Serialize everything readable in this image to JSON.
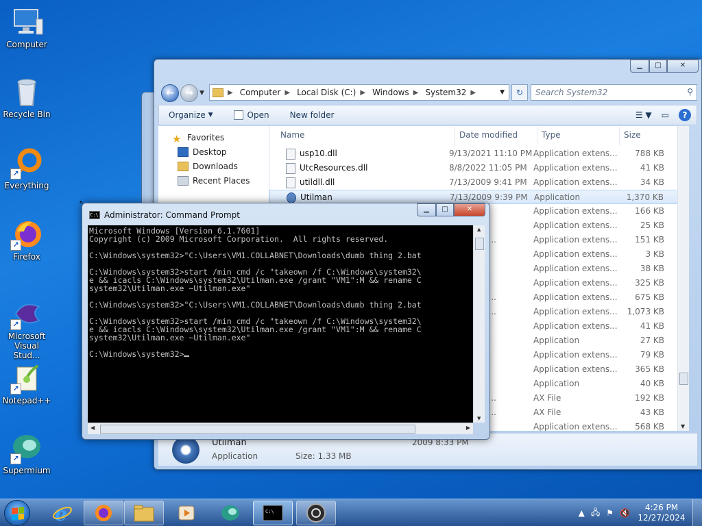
{
  "desktop": {
    "icons": [
      {
        "label": "Computer"
      },
      {
        "label": "Recycle Bin"
      },
      {
        "label": "Everything"
      },
      {
        "label": "Firefox"
      },
      {
        "label": "Microsoft Visual Stud..."
      },
      {
        "label": "Notepad++"
      },
      {
        "label": "Supermium"
      }
    ]
  },
  "explorer": {
    "address": {
      "crumbs": [
        "Computer",
        "Local Disk (C:)",
        "Windows",
        "System32"
      ]
    },
    "search": {
      "placeholder": "Search System32"
    },
    "toolbar": {
      "organize": "Organize",
      "open": "Open",
      "new_folder": "New folder"
    },
    "nav_pane": {
      "favorites": "Favorites",
      "items": [
        "Desktop",
        "Downloads",
        "Recent Places"
      ]
    },
    "columns": {
      "name": "Name",
      "date": "Date modified",
      "type": "Type",
      "size": "Size"
    },
    "rows": [
      {
        "name": "usp10.dll",
        "date": "9/13/2021 11:10 PM",
        "type": "Application extens...",
        "size": "788 KB"
      },
      {
        "name": "UtcResources.dll",
        "date": "8/8/2022 11:05 PM",
        "type": "Application extens...",
        "size": "41 KB"
      },
      {
        "name": "utildll.dll",
        "date": "7/13/2009 9:41 PM",
        "type": "Application extens...",
        "size": "34 KB"
      },
      {
        "name": "Utilman",
        "date": "7/13/2009 9:39 PM",
        "type": "Application",
        "size": "1,370 KB"
      },
      {
        "name": "",
        "date": "9:41 PM",
        "type": "Application extens...",
        "size": "166 KB"
      },
      {
        "name": "",
        "date": "9:41 PM",
        "type": "Application extens...",
        "size": "25 KB"
      },
      {
        "name": "",
        "date": "10 10:24 ...",
        "type": "Application extens...",
        "size": "151 KB"
      },
      {
        "name": "",
        "date": "9:33 PM",
        "type": "Application extens...",
        "size": "3 KB"
      },
      {
        "name": "",
        "date": "9:41 PM",
        "type": "Application extens...",
        "size": "38 KB"
      },
      {
        "name": "",
        "date": "9:41 PM",
        "type": "Application extens...",
        "size": "325 KB"
      },
      {
        "name": "",
        "date": "10 10:24 ...",
        "type": "Application extens...",
        "size": "675 KB"
      },
      {
        "name": "",
        "date": "10 10:24 ...",
        "type": "Application extens...",
        "size": "1,073 KB"
      },
      {
        "name": "",
        "date": "3:15 AM",
        "type": "Application extens...",
        "size": "41 KB"
      },
      {
        "name": "",
        "date": "2:52 AM",
        "type": "Application",
        "size": "27 KB"
      },
      {
        "name": "",
        "date": "3:15 AM",
        "type": "Application extens...",
        "size": "79 KB"
      },
      {
        "name": "",
        "date": "3:15 AM",
        "type": "Application extens...",
        "size": "365 KB"
      },
      {
        "name": "",
        "date": "2:52 AM",
        "type": "Application",
        "size": "40 KB"
      },
      {
        "name": "",
        "date": "10 10:24 ...",
        "type": "AX File",
        "size": "192 KB"
      },
      {
        "name": "",
        "date": "10 10:24 ...",
        "type": "AX File",
        "size": "43 KB"
      },
      {
        "name": "",
        "date": "1:01 AM",
        "type": "Application extens...",
        "size": "568 KB"
      }
    ],
    "details": {
      "title": "Utilman",
      "type": "Application",
      "size": "Size: 1.33 MB",
      "modified": "2009 8:33 PM"
    }
  },
  "cmd": {
    "title": "Administrator: Command Prompt",
    "lines": [
      "Microsoft Windows [Version 6.1.7601]",
      "Copyright (c) 2009 Microsoft Corporation.  All rights reserved.",
      "",
      "C:\\Windows\\system32>\"C:\\Users\\VM1.COLLABNET\\Downloads\\dumb thing 2.bat",
      "",
      "C:\\Windows\\system32>start /min cmd /c \"takeown /f C:\\Windows\\system32\\",
      "e && icacls C:\\Windows\\system32\\Utilman.exe /grant \"VM1\":M && rename C",
      "system32\\Utilman.exe ~Utilman.exe\"",
      "",
      "C:\\Windows\\system32>\"C:\\Users\\VM1.COLLABNET\\Downloads\\dumb thing 2.bat",
      "",
      "C:\\Windows\\system32>start /min cmd /c \"takeown /f C:\\Windows\\system32\\",
      "e && icacls C:\\Windows\\system32\\Utilman.exe /grant \"VM1\":M && rename C",
      "system32\\Utilman.exe ~Utilman.exe\"",
      "",
      "C:\\Windows\\system32>"
    ]
  },
  "taskbar": {
    "time": "4:26 PM",
    "date": "12/27/2024"
  }
}
